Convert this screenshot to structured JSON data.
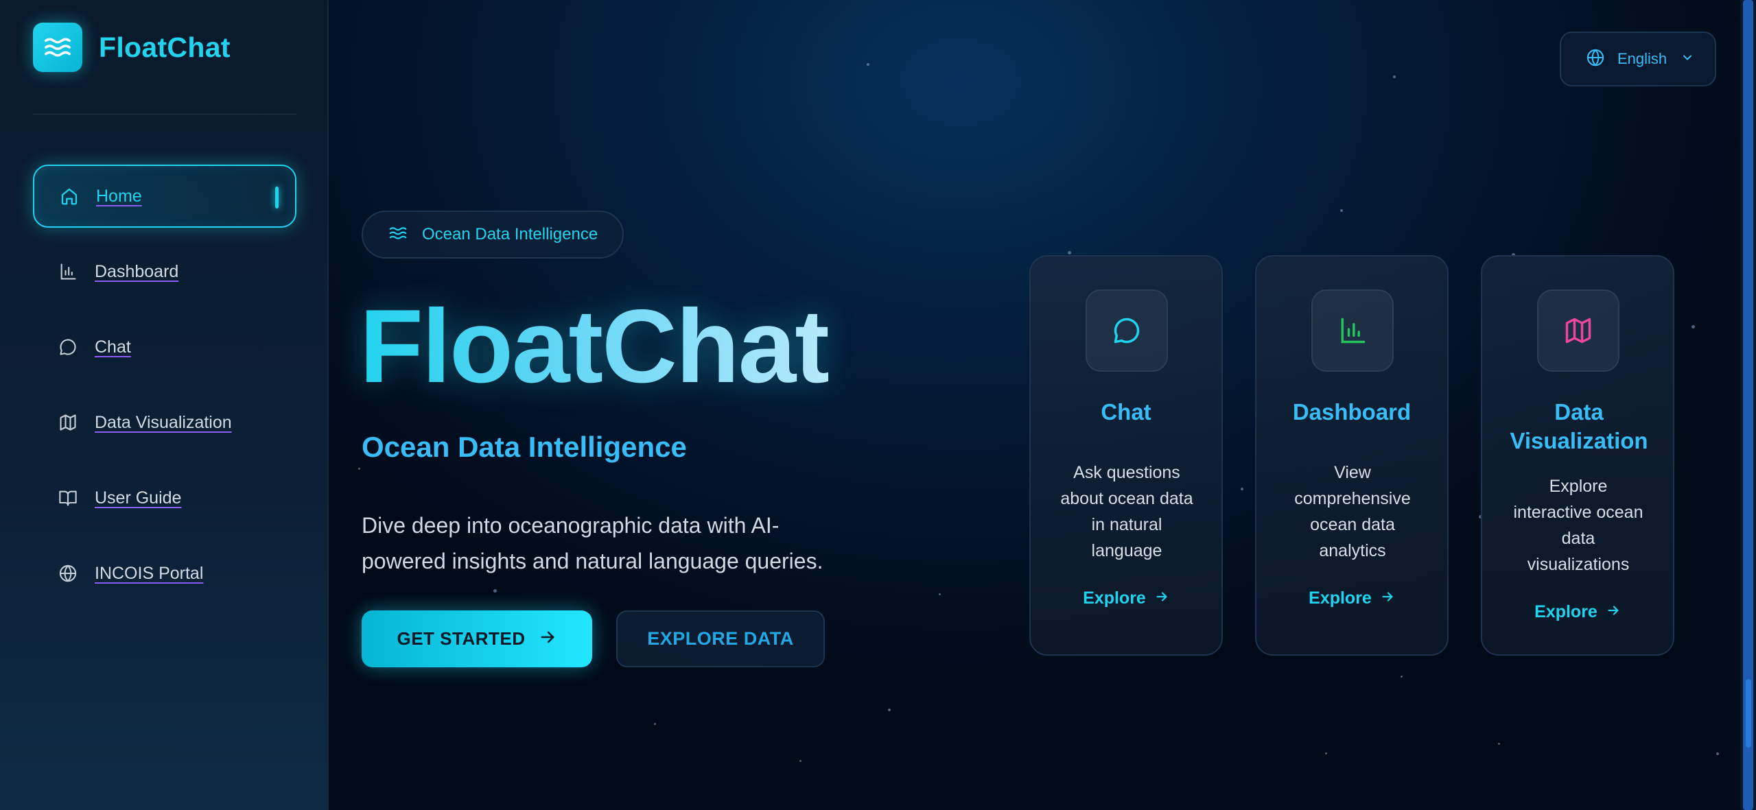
{
  "app": {
    "name": "FloatChat"
  },
  "sidebar": {
    "items": [
      {
        "label": "Home",
        "icon": "home-icon",
        "active": true
      },
      {
        "label": "Dashboard",
        "icon": "bar-chart-icon",
        "active": false
      },
      {
        "label": "Chat",
        "icon": "chat-bubble-icon",
        "active": false
      },
      {
        "label": "Data Visualization",
        "icon": "map-icon",
        "active": false
      },
      {
        "label": "User Guide",
        "icon": "book-icon",
        "active": false
      },
      {
        "label": "INCOIS Portal",
        "icon": "globe-icon",
        "active": false
      }
    ]
  },
  "language": {
    "label": "English",
    "icon": "globe-icon"
  },
  "hero": {
    "badge": "Ocean Data Intelligence",
    "title": "FloatChat",
    "subtitle": "Ocean Data Intelligence",
    "description": "Dive deep into oceanographic data with AI-powered insights and natural language queries.",
    "primary_button": "GET STARTED",
    "secondary_button": "EXPLORE DATA"
  },
  "cards": [
    {
      "title": "Chat",
      "description": "Ask questions about ocean data in natural language",
      "link": "Explore",
      "icon": "chat-bubble-icon",
      "icon_color": "#22d3ee"
    },
    {
      "title": "Dashboard",
      "description": "View comprehensive ocean data analytics",
      "link": "Explore",
      "icon": "bar-chart-icon",
      "icon_color": "#22c55e"
    },
    {
      "title": "Data Visualization",
      "description": "Explore interactive ocean data visualizations",
      "link": "Explore",
      "icon": "map-icon",
      "icon_color": "#ec4899"
    }
  ],
  "colors": {
    "accent": "#22d3ee",
    "brand_blue": "#38bdf8",
    "background": "#021329"
  }
}
